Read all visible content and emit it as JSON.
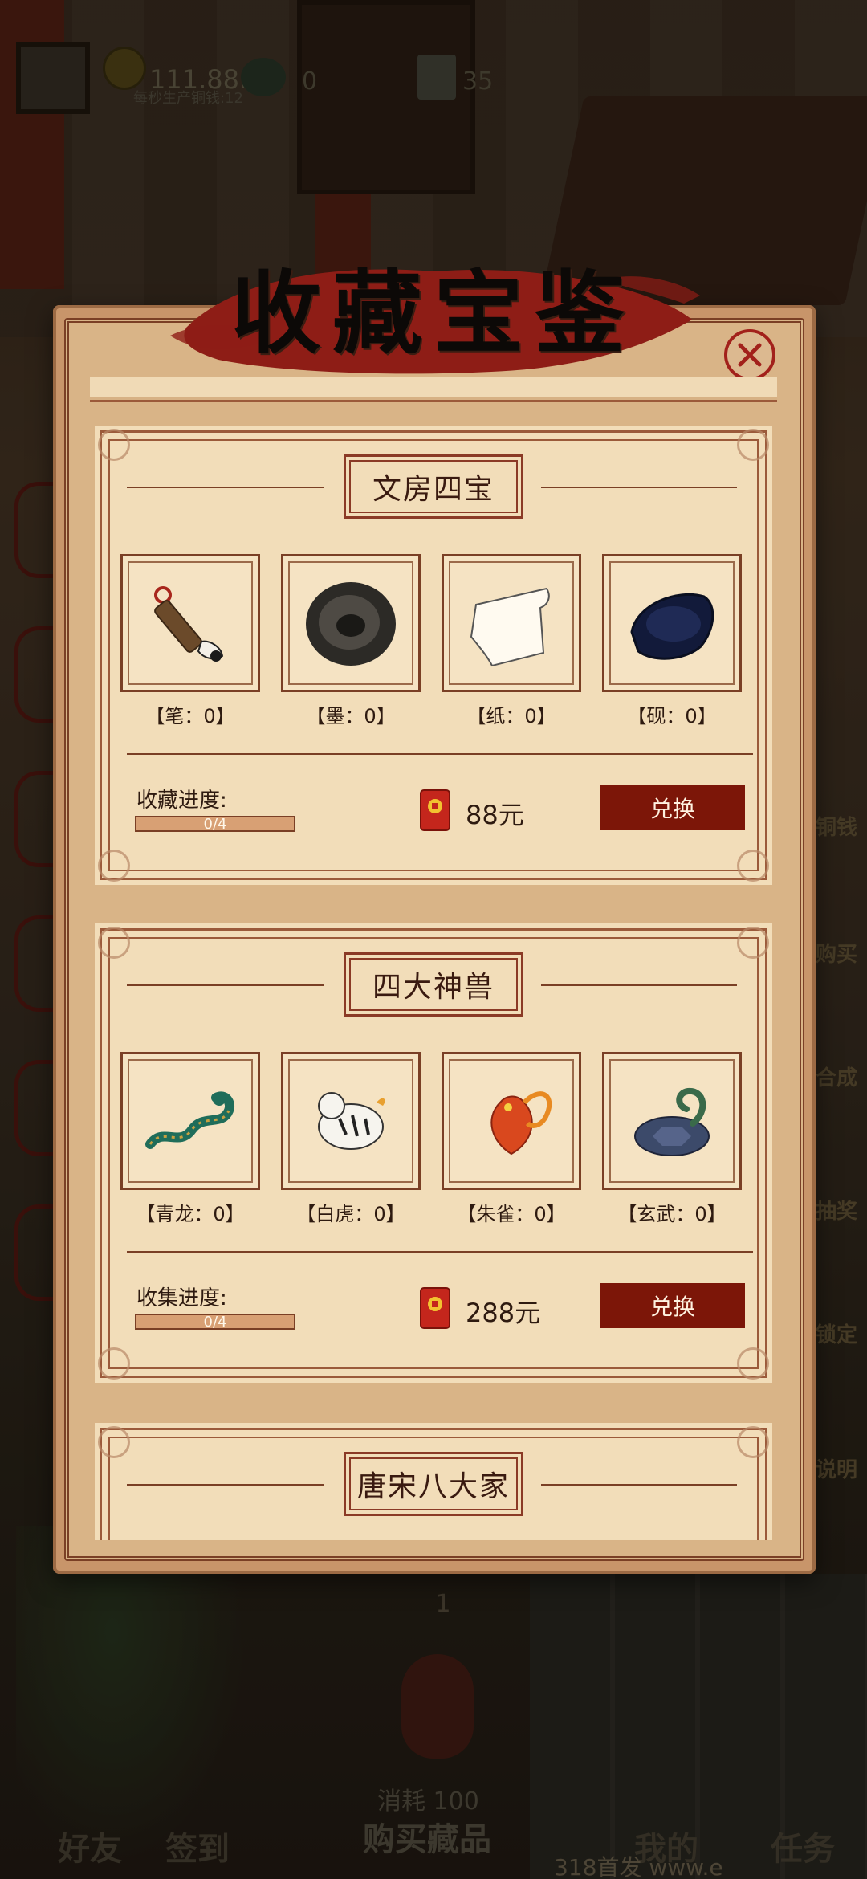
{
  "hud": {
    "coins": "111.88K",
    "coin_rate": "每秒生产铜钱:12",
    "jade": "0",
    "bag": "35"
  },
  "right_menu": [
    "铜钱",
    "购买",
    "合成",
    "抽奖",
    "锁定",
    "说明"
  ],
  "modal": {
    "title": "收藏宝鉴",
    "sets": [
      {
        "name": "文房四宝",
        "items": [
          {
            "label": "【笔：0】",
            "icon": "brush-icon"
          },
          {
            "label": "【墨：0】",
            "icon": "ink-icon"
          },
          {
            "label": "【纸：0】",
            "icon": "paper-icon"
          },
          {
            "label": "【砚：0】",
            "icon": "inkstone-icon"
          }
        ],
        "progress_label": "收藏进度:",
        "progress": "0/4",
        "progress_fraction": 0,
        "reward": "88元",
        "button": "兑换"
      },
      {
        "name": "四大神兽",
        "items": [
          {
            "label": "【青龙：0】",
            "icon": "azure-dragon-icon"
          },
          {
            "label": "【白虎：0】",
            "icon": "white-tiger-icon"
          },
          {
            "label": "【朱雀：0】",
            "icon": "vermilion-bird-icon"
          },
          {
            "label": "【玄武：0】",
            "icon": "black-tortoise-icon"
          }
        ],
        "progress_label": "收集进度:",
        "progress": "0/4",
        "progress_fraction": 0,
        "reward": "288元",
        "button": "兑换"
      },
      {
        "name": "唐宋八大家"
      }
    ]
  },
  "page_indicator": "1",
  "buy": {
    "cost": "消耗 100",
    "label": "购买藏品"
  },
  "nav": [
    "好友",
    "签到",
    "我的",
    "任务"
  ],
  "watermark": "318首发 www.e"
}
